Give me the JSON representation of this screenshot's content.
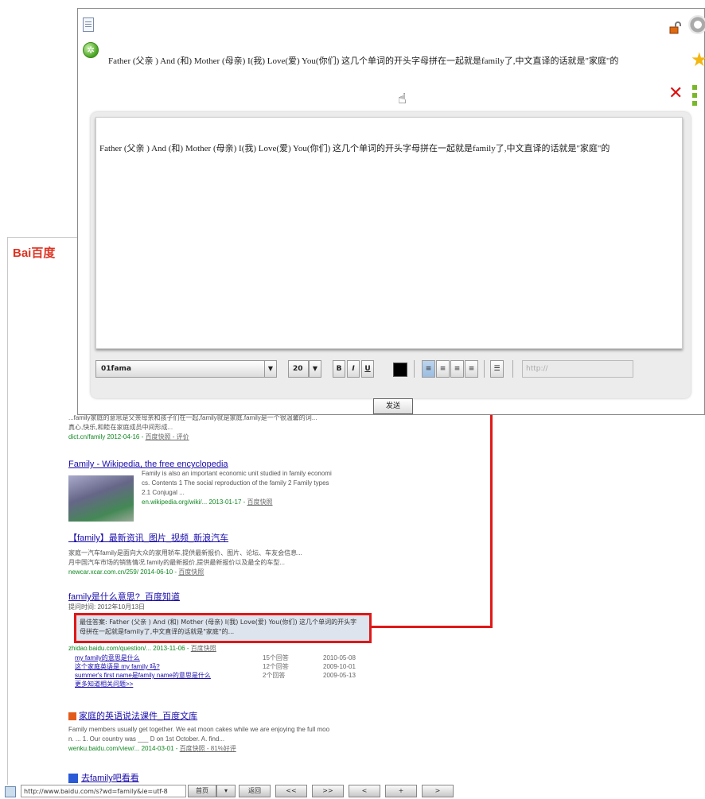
{
  "popup": {
    "quote": "Father (父亲 ) And (和) Mother (母亲) I(我) Love(爱) You(你们) 这几个单词的开头字母拼在一起就是family了,中文直译的话就是\"家庭\"的",
    "editor_text": "Father (父亲 ) And (和) Mother (母亲) I(我) Love(爱) You(你们) 这几个单词的开头字母拼在一起就是family了,中文直译的话就是\"家庭\"的",
    "toolbar": {
      "font": "01fama",
      "font_size": "20",
      "bold": "B",
      "italic": "I",
      "underline": "U",
      "link_placeholder": "http://",
      "font_color": "#000000"
    },
    "submit_label": "发送"
  },
  "baidu": {
    "logo": "Bai百度",
    "results": [
      {
        "snippet": [
          "...family家庭的意思是父亲母亲和孩子们在一起,family就是家庭,family是一个很温馨的词...",
          "真心,快乐,和睦在家庭成员中间形成..."
        ],
        "url": "dict.cn/family 2012-04-16",
        "extra": "百度快照 - 评价"
      },
      {
        "title": "Family - Wikipedia, the free encyclopedia",
        "snippet": [
          "Family is also an important economic unit studied in family economi",
          "cs. Contents 1 The social reproduction of the family 2 Family types",
          "2.1 Conjugal ..."
        ],
        "url": "en.wikipedia.org/wiki/... 2013-01-17",
        "extra": "百度快照"
      },
      {
        "title": "【family】最新资讯_图片_视频_新浪汽车",
        "snippet": [
          "家庭一汽车family是面向大众的家用轿车,提供最新报价、图片、论坛、车友会信息...",
          "月中国汽车市场的销售情况.family的最新报价,提供最新报价以及最全的车型..."
        ],
        "url": "newcar.xcar.com.cn/259/ 2014-06-10",
        "extra": "百度快照"
      },
      {
        "title": "family是什么意思?_百度知道",
        "meta": "提问时间: 2012年10月13日",
        "snippet": [
          "最佳答案: Father (父亲 ) And (和) Mother (母亲) I(我) Love(爱) You(你们) 这几个单词的开头字",
          "母拼在一起就是family了,中文直译的话就是\"家庭\"的..."
        ],
        "url": "zhidao.baidu.com/question/... 2013-11-06",
        "extra": "百度快照",
        "sub": [
          {
            "t": "my family的意思是什么",
            "c": "15个回答",
            "d": "2010-05-08"
          },
          {
            "t": "这个家庭英语是 my family 吗?",
            "c": "12个回答",
            "d": "2009-10-01"
          },
          {
            "t": "summer's first name是family name的意思是什么",
            "c": "2个回答",
            "d": "2009-05-13"
          }
        ],
        "more": "更多知道相关问题>>"
      },
      {
        "title": "家庭的英语说法课件_百度文库",
        "snippet": [
          "Family members usually get together. We eat moon cakes while we are enjoying the full moo",
          "n. ... 1. Our country was ___ D on 1st October. A. find..."
        ],
        "url": "wenku.baidu.com/view/... 2014-03-01",
        "extra": "百度快照 - 81%好评"
      },
      {
        "title": "去family吧看看"
      }
    ]
  },
  "statusbar": {
    "url": "http://www.baidu.com/s?wd=family&ie=utf-8",
    "buttons": [
      "首页",
      "▾",
      "返回",
      "<<",
      ">>",
      "<",
      "+",
      ">"
    ]
  },
  "colors": {
    "highlight_red": "#e01818",
    "link_blue": "#1a0dab",
    "url_green": "#118822"
  }
}
